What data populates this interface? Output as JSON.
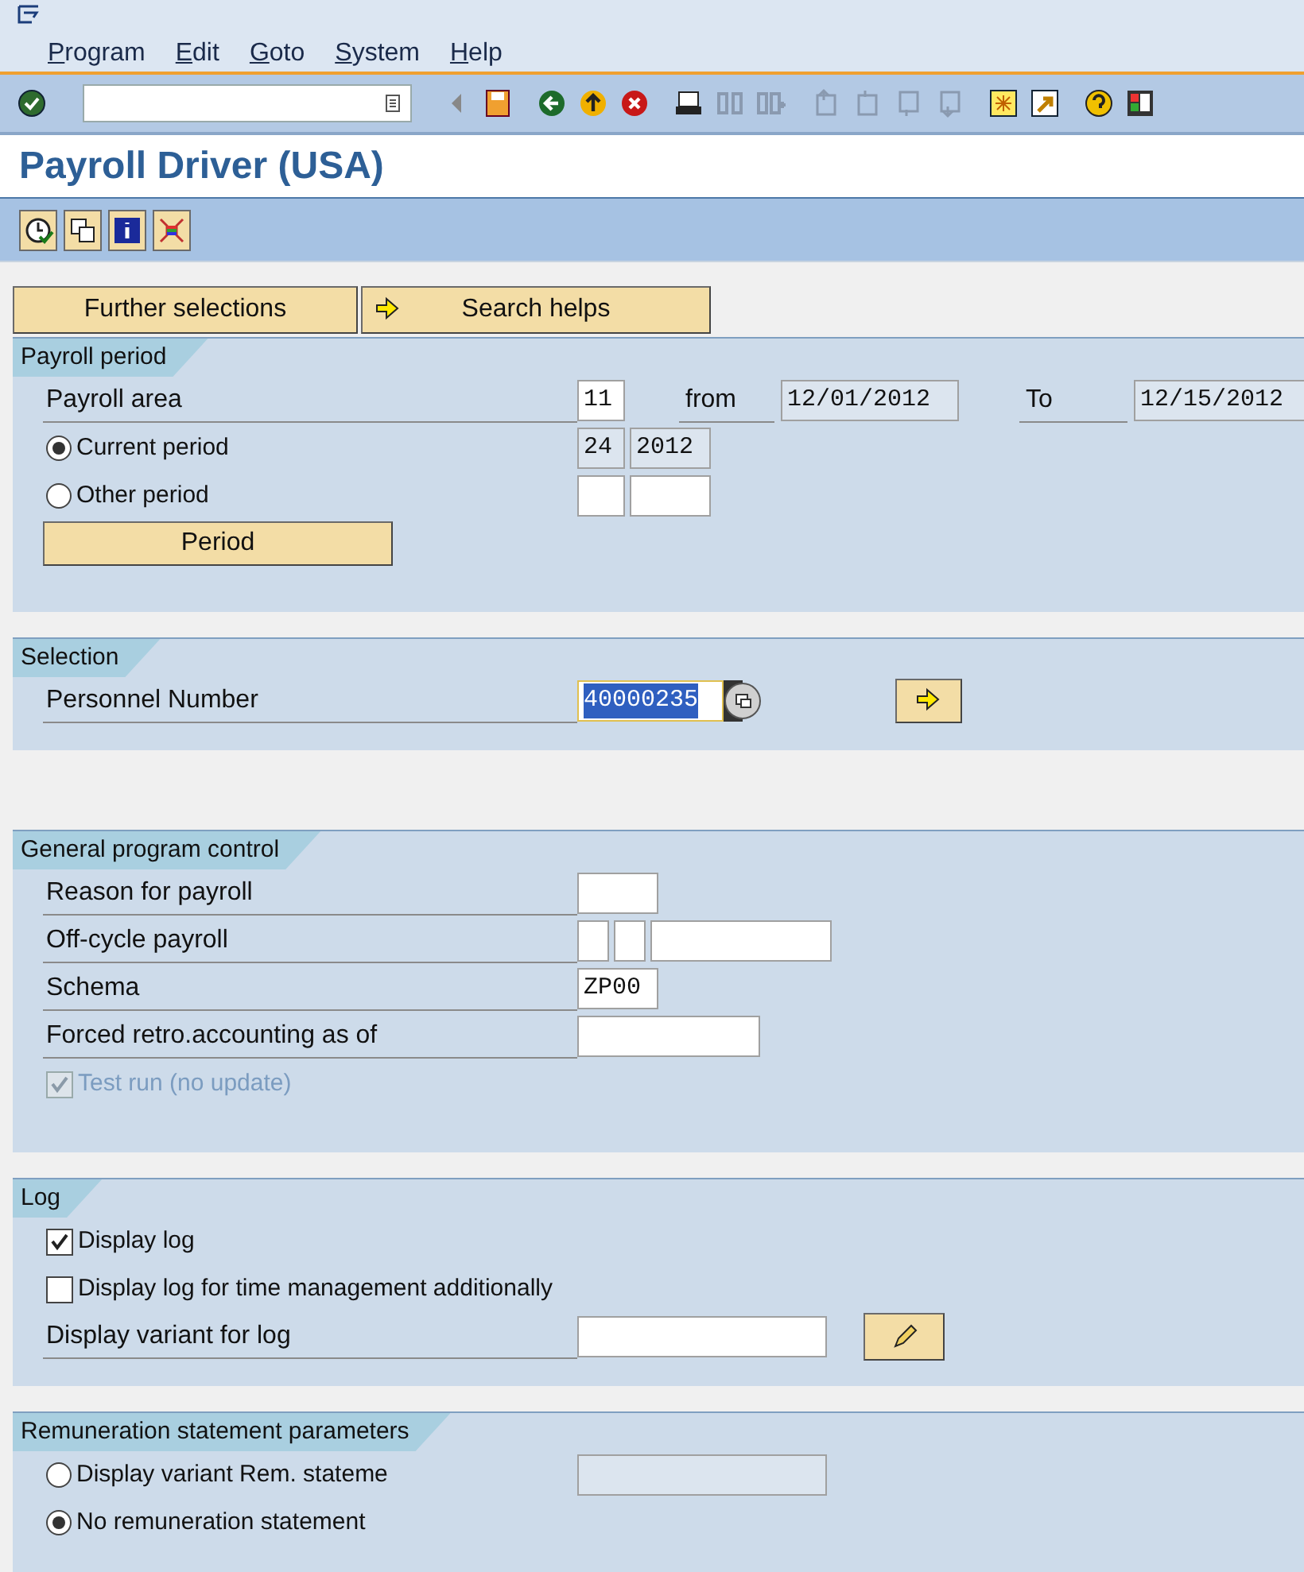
{
  "menu_bar": {
    "items": [
      "Program",
      "Edit",
      "Goto",
      "System",
      "Help"
    ]
  },
  "title": "Payroll Driver (USA)",
  "top_buttons": [
    {
      "label": "Further selections",
      "kind": "text"
    },
    {
      "label": "Search helps",
      "kind": "arrow"
    }
  ],
  "sections": [
    {
      "title": "Payroll period",
      "rows": [
        {
          "kind": "field",
          "label": "Payroll area",
          "inputs": [
            {
              "value": "11",
              "readonly": false
            },
            {
              "label": "from",
              "value": "12/01/2012",
              "readonly": true
            },
            {
              "label": "To",
              "value": "12/15/2012",
              "readonly": true
            }
          ]
        },
        {
          "kind": "radio",
          "label": "Current period",
          "selected": true,
          "inputs": [
            {
              "value": "24",
              "readonly": true
            },
            {
              "value": "2012",
              "readonly": true
            }
          ]
        },
        {
          "kind": "radio",
          "label": "Other period",
          "selected": false,
          "inputs": [
            {
              "readonly": false
            },
            {
              "readonly": false
            }
          ]
        },
        {
          "kind": "button",
          "label": "Period"
        }
      ]
    },
    {
      "title": "Selection",
      "rows": [
        {
          "kind": "field_multi",
          "label": "Personnel Number",
          "inputs": [
            {
              "value": "40000235",
              "readonly": false,
              "highlighted": true
            }
          ]
        }
      ]
    },
    {
      "title": "General program control",
      "rows": [
        {
          "kind": "field",
          "label": "Reason for payroll",
          "inputs": [
            {
              "readonly": false
            }
          ]
        },
        {
          "kind": "field",
          "label": "Off-cycle payroll",
          "inputs": [
            {
              "readonly": false
            },
            {
              "readonly": false
            },
            {
              "readonly": false
            }
          ]
        },
        {
          "kind": "field",
          "label": "Schema",
          "inputs": [
            {
              "value": "ZP00",
              "readonly": false
            }
          ]
        },
        {
          "kind": "field",
          "label": "Forced retro.accounting as of",
          "inputs": [
            {
              "readonly": false
            }
          ]
        },
        {
          "kind": "checkbox",
          "label": "Test run (no update)",
          "checked": true,
          "disabled": true
        }
      ]
    },
    {
      "title": "Log",
      "rows": [
        {
          "kind": "checkbox",
          "label": "Display log",
          "checked": true,
          "disabled": false
        },
        {
          "kind": "checkbox",
          "label": "Display log for time management additionally",
          "checked": false,
          "disabled": false
        },
        {
          "kind": "field_edit",
          "label": "Display variant for log",
          "inputs": [
            {
              "readonly": false
            }
          ]
        }
      ]
    },
    {
      "title": "Remuneration statement parameters",
      "rows": [
        {
          "kind": "radio",
          "label": "Display variant Rem. stateme",
          "selected": false,
          "inputs": [
            {
              "readonly": true
            }
          ]
        },
        {
          "kind": "radio",
          "label": "No remuneration statement",
          "selected": true
        }
      ]
    }
  ]
}
